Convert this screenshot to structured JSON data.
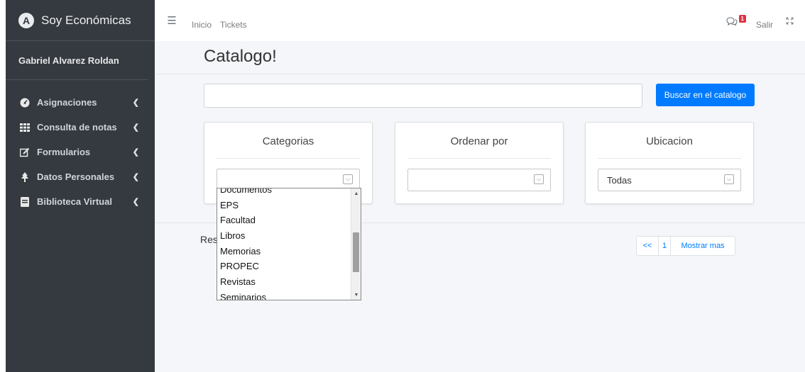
{
  "app": {
    "brand": "Soy Económicas",
    "logo_letter": "A"
  },
  "user": {
    "name": "Gabriel Alvarez Roldan"
  },
  "sidebar": {
    "items": [
      {
        "label": "Asignaciones",
        "icon": "tachometer-icon"
      },
      {
        "label": "Consulta de notas",
        "icon": "grid-icon"
      },
      {
        "label": "Formularios",
        "icon": "edit-icon"
      },
      {
        "label": "Datos Personales",
        "icon": "tree-icon"
      },
      {
        "label": "Biblioteca Virtual",
        "icon": "book-icon"
      }
    ]
  },
  "header": {
    "links": [
      "Inicio",
      "Tickets"
    ],
    "badge_count": "1",
    "logout": "Salir"
  },
  "page": {
    "title": "Catalogo!",
    "search": {
      "value": "",
      "button": "Buscar en el catalogo"
    },
    "filters": [
      {
        "title": "Categorias",
        "selected": ""
      },
      {
        "title": "Ordenar por",
        "selected": ""
      },
      {
        "title": "Ubicacion",
        "selected": "Todas"
      }
    ],
    "results_label": "Res",
    "pagination": {
      "prev": "<<",
      "page": "1",
      "more": "Mostrar mas"
    }
  },
  "dropdown": {
    "options": [
      "Documentos",
      "EPS",
      "Facultad",
      "Libros",
      "Memorias",
      "PROPEC",
      "Revistas",
      "Seminarios"
    ]
  },
  "colors": {
    "sidebar_bg": "#343a40",
    "primary": "#007bff",
    "badge": "#dc3545"
  }
}
